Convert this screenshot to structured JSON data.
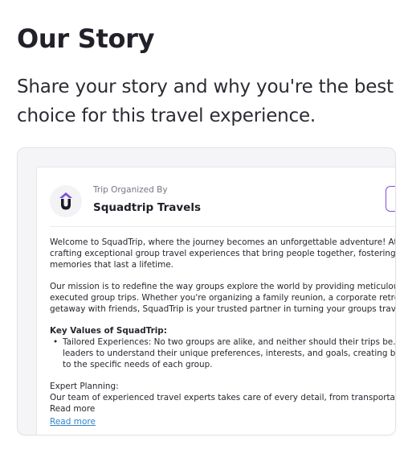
{
  "header": {
    "title": "Our Story",
    "subtitle": "Share your story and why you're the best choice for this travel experience."
  },
  "card": {
    "organizer_caption": "Trip Organized By",
    "organizer_name": "Squadtrip Travels",
    "logo_icon": "squadtrip-logo-icon",
    "accent_color": "#7b4fd6",
    "paragraph_1": [
      "Welcome to SquadTrip, where the journey becomes an unforgettable adventure! At S",
      "crafting exceptional group travel experiences that bring people together, fostering b",
      "memories that last a lifetime."
    ],
    "paragraph_2": [
      "Our mission is to redefine the way groups explore the world by providing meticulousl",
      "executed group trips. Whether you're organizing a family reunion, a corporate retreat",
      "getaway with friends, SquadTrip is your trusted partner in turning your groups travel"
    ],
    "values_heading": "Key Values of SquadTrip:",
    "bullet_1": [
      "Tailored Experiences: No two groups are alike, and neither should their trips be. We",
      "leaders to understand their unique preferences, interests, and goals, creating bes",
      "to the specific needs of each group."
    ],
    "expert_heading": "Expert Planning:",
    "expert_line": "Our team of experienced travel experts takes care of every detail, from transportatio",
    "read_more_inline": "Read more",
    "read_more_link": "Read more",
    "link_color": "#2f86c9"
  }
}
